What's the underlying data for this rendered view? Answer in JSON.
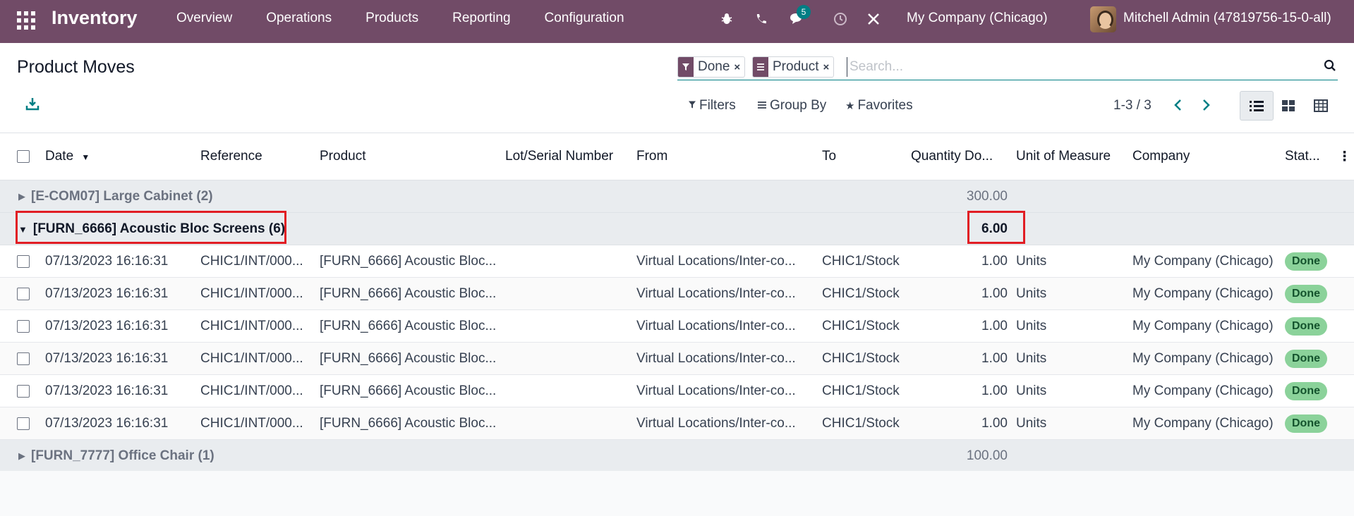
{
  "navbar": {
    "app_name": "Inventory",
    "menu": [
      "Overview",
      "Operations",
      "Products",
      "Reporting",
      "Configuration"
    ],
    "messages_badge": "5",
    "company": "My Company (Chicago)",
    "user": "Mitchell Admin (47819756-15-0-all)"
  },
  "control": {
    "title": "Product Moves",
    "facets": [
      {
        "label": "Done",
        "icon": "filter-icon"
      },
      {
        "label": "Product",
        "icon": "group-by-icon"
      }
    ],
    "search_placeholder": "Search...",
    "filters_label": "Filters",
    "groupby_label": "Group By",
    "favorites_label": "Favorites",
    "pager": "1-3 / 3"
  },
  "table": {
    "columns": [
      "Date",
      "Reference",
      "Product",
      "Lot/Serial Number",
      "From",
      "To",
      "Quantity Do...",
      "Unit of Measure",
      "Company",
      "Stat..."
    ],
    "groups": [
      {
        "label": "[E-COM07] Large Cabinet (2)",
        "qty": "300.00",
        "open": false
      },
      {
        "label": "[FURN_6666] Acoustic Bloc Screens (6)",
        "qty": "6.00",
        "open": true
      },
      {
        "label": "[FURN_7777] Office Chair (1)",
        "qty": "100.00",
        "open": false
      }
    ],
    "rows": [
      {
        "date": "07/13/2023 16:16:31",
        "reference": "CHIC1/INT/000...",
        "product": "[FURN_6666] Acoustic Bloc...",
        "lot": "",
        "from": "Virtual Locations/Inter-co...",
        "to": "CHIC1/Stock",
        "qty": "1.00",
        "uom": "Units",
        "company": "My Company (Chicago)",
        "status": "Done"
      },
      {
        "date": "07/13/2023 16:16:31",
        "reference": "CHIC1/INT/000...",
        "product": "[FURN_6666] Acoustic Bloc...",
        "lot": "",
        "from": "Virtual Locations/Inter-co...",
        "to": "CHIC1/Stock",
        "qty": "1.00",
        "uom": "Units",
        "company": "My Company (Chicago)",
        "status": "Done"
      },
      {
        "date": "07/13/2023 16:16:31",
        "reference": "CHIC1/INT/000...",
        "product": "[FURN_6666] Acoustic Bloc...",
        "lot": "",
        "from": "Virtual Locations/Inter-co...",
        "to": "CHIC1/Stock",
        "qty": "1.00",
        "uom": "Units",
        "company": "My Company (Chicago)",
        "status": "Done"
      },
      {
        "date": "07/13/2023 16:16:31",
        "reference": "CHIC1/INT/000...",
        "product": "[FURN_6666] Acoustic Bloc...",
        "lot": "",
        "from": "Virtual Locations/Inter-co...",
        "to": "CHIC1/Stock",
        "qty": "1.00",
        "uom": "Units",
        "company": "My Company (Chicago)",
        "status": "Done"
      },
      {
        "date": "07/13/2023 16:16:31",
        "reference": "CHIC1/INT/000...",
        "product": "[FURN_6666] Acoustic Bloc...",
        "lot": "",
        "from": "Virtual Locations/Inter-co...",
        "to": "CHIC1/Stock",
        "qty": "1.00",
        "uom": "Units",
        "company": "My Company (Chicago)",
        "status": "Done"
      },
      {
        "date": "07/13/2023 16:16:31",
        "reference": "CHIC1/INT/000...",
        "product": "[FURN_6666] Acoustic Bloc...",
        "lot": "",
        "from": "Virtual Locations/Inter-co...",
        "to": "CHIC1/Stock",
        "qty": "1.00",
        "uom": "Units",
        "company": "My Company (Chicago)",
        "status": "Done"
      }
    ]
  },
  "colors": {
    "navbar": "#714b67",
    "accent": "#017e84",
    "highlight": "#e11d24",
    "done_badge": "#8bd29a"
  }
}
